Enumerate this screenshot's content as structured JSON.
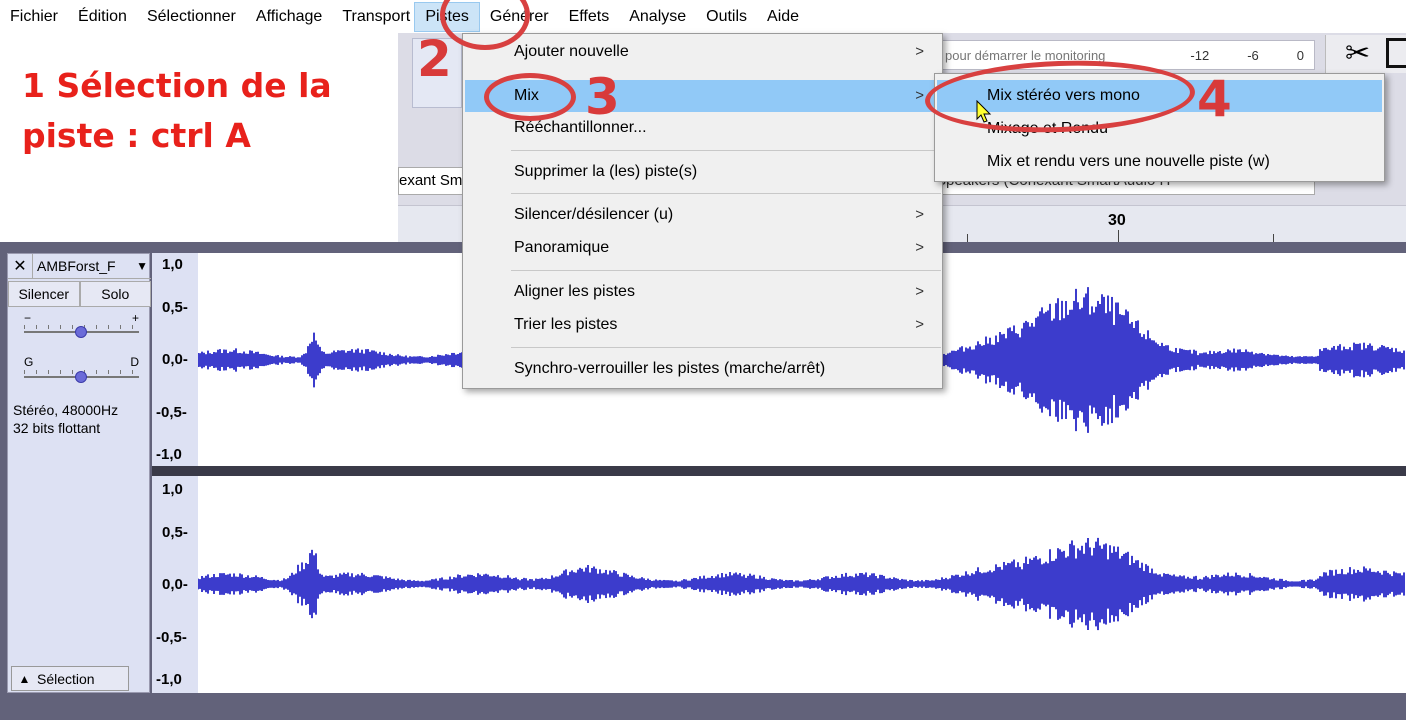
{
  "menubar": {
    "items": [
      "Fichier",
      "Édition",
      "Sélectionner",
      "Affichage",
      "Transport",
      "Pistes",
      "Générer",
      "Effets",
      "Analyse",
      "Outils",
      "Aide"
    ],
    "active_index": 5
  },
  "annotation": {
    "text": "1 Sélection de la piste : ctrl A",
    "steps": [
      "2",
      "3",
      "4"
    ],
    "color": "#e8211b"
  },
  "toolbar": {
    "meter_text": "pour démarrer le monitoring",
    "meter_scale": [
      "-12",
      "-6",
      "0"
    ],
    "input_device": "exant Sm",
    "output_device": "Speakers (Conexant SmartAudio H"
  },
  "timeline": {
    "visible_label": "30"
  },
  "pistes_menu": {
    "items": [
      {
        "label": "Ajouter nouvelle",
        "submenu": true
      },
      {
        "label": "Mix",
        "submenu": true,
        "highlighted": true
      },
      {
        "label": "Rééchantillonner...",
        "submenu": false
      },
      {
        "label": "Supprimer la (les) piste(s)",
        "submenu": false
      },
      {
        "label": "Silencer/désilencer (u)",
        "submenu": true
      },
      {
        "label": "Panoramique",
        "submenu": true
      },
      {
        "label": "Aligner les pistes",
        "submenu": true
      },
      {
        "label": "Trier les pistes",
        "submenu": true
      },
      {
        "label": "Synchro-verrouiller les pistes (marche/arrêt)",
        "submenu": false
      }
    ]
  },
  "mix_submenu": {
    "items": [
      {
        "label": "Mix stéréo vers mono",
        "highlighted": true
      },
      {
        "label": "Mixage et Rendu",
        "highlighted": false
      },
      {
        "label": "Mix et rendu vers une nouvelle piste (w)",
        "highlighted": false
      }
    ]
  },
  "track": {
    "name": "AMBForst_F",
    "mute_label": "Silencer",
    "solo_label": "Solo",
    "gain_minus": "−",
    "gain_plus": "+",
    "pan_left": "G",
    "pan_right": "D",
    "info_line1": "Stéréo, 48000Hz",
    "info_line2": "32 bits flottant",
    "select_label": "Sélection",
    "scale_labels": [
      "1,0",
      "0,5-",
      "0,0-",
      "-0,5-",
      "-1,0"
    ],
    "wave_color": "#3c3ccc"
  }
}
